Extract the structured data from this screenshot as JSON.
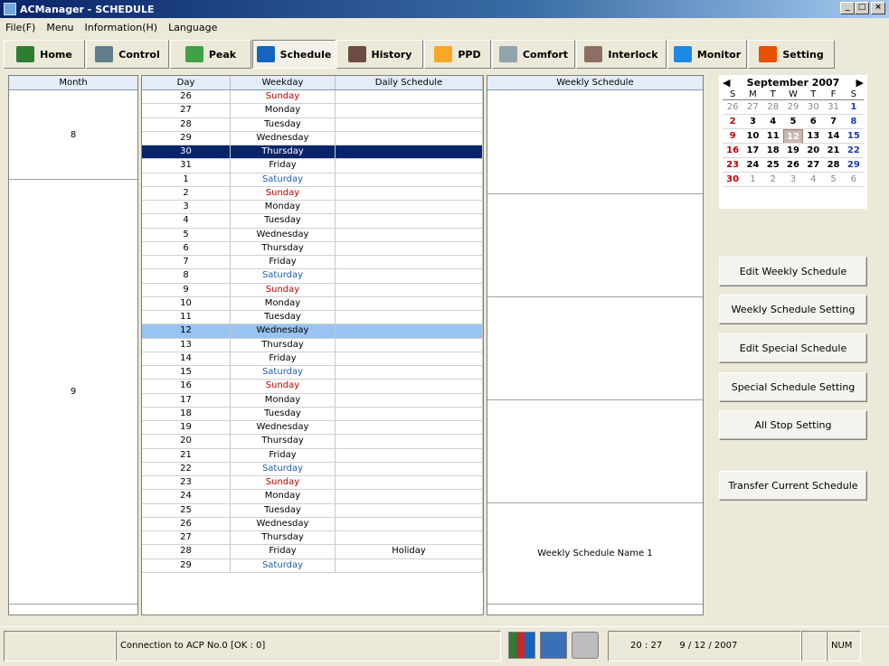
{
  "window": {
    "title": "ACManager - SCHEDULE"
  },
  "menu": [
    "File(F)",
    "Menu",
    "Information(H)",
    "Language"
  ],
  "toolbar": [
    {
      "label": "Home",
      "icon": "home-icon",
      "color": "#2e7d32"
    },
    {
      "label": "Control",
      "icon": "control-icon",
      "color": "#607d8b"
    },
    {
      "label": "Peak",
      "icon": "peak-icon",
      "color": "#43a047"
    },
    {
      "label": "Schedule",
      "icon": "clock-icon",
      "color": "#1565c0",
      "active": true
    },
    {
      "label": "History",
      "icon": "history-icon",
      "color": "#6d4c41"
    },
    {
      "label": "PPD",
      "icon": "ppd-icon",
      "color": "#f9a825"
    },
    {
      "label": "Comfort",
      "icon": "comfort-icon",
      "color": "#90a4ae"
    },
    {
      "label": "Interlock",
      "icon": "interlock-icon",
      "color": "#8d6e63"
    },
    {
      "label": "Monitor",
      "icon": "monitor-icon",
      "color": "#1e88e5"
    },
    {
      "label": "Setting",
      "icon": "setting-icon",
      "color": "#e65100"
    }
  ],
  "month_panel": {
    "header": "Month",
    "months": [
      "8",
      "9"
    ]
  },
  "day_panel": {
    "headers": {
      "day": "Day",
      "weekday": "Weekday",
      "daily": "Daily Schedule"
    },
    "rows": [
      {
        "day": "26",
        "weekday": "Sunday",
        "daily": ""
      },
      {
        "day": "27",
        "weekday": "Monday",
        "daily": ""
      },
      {
        "day": "28",
        "weekday": "Tuesday",
        "daily": ""
      },
      {
        "day": "29",
        "weekday": "Wednesday",
        "daily": ""
      },
      {
        "day": "30",
        "weekday": "Thursday",
        "daily": "",
        "sel": "dark"
      },
      {
        "day": "31",
        "weekday": "Friday",
        "daily": ""
      },
      {
        "day": "1",
        "weekday": "Saturday",
        "daily": ""
      },
      {
        "day": "2",
        "weekday": "Sunday",
        "daily": ""
      },
      {
        "day": "3",
        "weekday": "Monday",
        "daily": ""
      },
      {
        "day": "4",
        "weekday": "Tuesday",
        "daily": ""
      },
      {
        "day": "5",
        "weekday": "Wednesday",
        "daily": ""
      },
      {
        "day": "6",
        "weekday": "Thursday",
        "daily": ""
      },
      {
        "day": "7",
        "weekday": "Friday",
        "daily": ""
      },
      {
        "day": "8",
        "weekday": "Saturday",
        "daily": ""
      },
      {
        "day": "9",
        "weekday": "Sunday",
        "daily": ""
      },
      {
        "day": "10",
        "weekday": "Monday",
        "daily": ""
      },
      {
        "day": "11",
        "weekday": "Tuesday",
        "daily": ""
      },
      {
        "day": "12",
        "weekday": "Wednesday",
        "daily": "",
        "sel": "light"
      },
      {
        "day": "13",
        "weekday": "Thursday",
        "daily": ""
      },
      {
        "day": "14",
        "weekday": "Friday",
        "daily": ""
      },
      {
        "day": "15",
        "weekday": "Saturday",
        "daily": ""
      },
      {
        "day": "16",
        "weekday": "Sunday",
        "daily": ""
      },
      {
        "day": "17",
        "weekday": "Monday",
        "daily": ""
      },
      {
        "day": "18",
        "weekday": "Tuesday",
        "daily": ""
      },
      {
        "day": "19",
        "weekday": "Wednesday",
        "daily": ""
      },
      {
        "day": "20",
        "weekday": "Thursday",
        "daily": ""
      },
      {
        "day": "21",
        "weekday": "Friday",
        "daily": ""
      },
      {
        "day": "22",
        "weekday": "Saturday",
        "daily": ""
      },
      {
        "day": "23",
        "weekday": "Sunday",
        "daily": ""
      },
      {
        "day": "24",
        "weekday": "Monday",
        "daily": ""
      },
      {
        "day": "25",
        "weekday": "Tuesday",
        "daily": ""
      },
      {
        "day": "26",
        "weekday": "Wednesday",
        "daily": ""
      },
      {
        "day": "27",
        "weekday": "Thursday",
        "daily": ""
      },
      {
        "day": "28",
        "weekday": "Friday",
        "daily": "Holiday"
      },
      {
        "day": "29",
        "weekday": "Saturday",
        "daily": ""
      }
    ]
  },
  "weekly_panel": {
    "header": "Weekly Schedule",
    "blocks": [
      "",
      "",
      "",
      "",
      "Weekly Schedule Name 1"
    ]
  },
  "calendar": {
    "title": "September 2007",
    "dow": [
      "S",
      "M",
      "T",
      "W",
      "T",
      "F",
      "S"
    ],
    "weeks": [
      [
        "26",
        "27",
        "28",
        "29",
        "30",
        "31",
        "1"
      ],
      [
        "2",
        "3",
        "4",
        "5",
        "6",
        "7",
        "8"
      ],
      [
        "9",
        "10",
        "11",
        "12",
        "13",
        "14",
        "15"
      ],
      [
        "16",
        "17",
        "18",
        "19",
        "20",
        "21",
        "22"
      ],
      [
        "23",
        "24",
        "25",
        "26",
        "27",
        "28",
        "29"
      ],
      [
        "30",
        "1",
        "2",
        "3",
        "4",
        "5",
        "6"
      ]
    ],
    "today": "12"
  },
  "actions": {
    "edit_weekly": "Edit Weekly Schedule",
    "weekly_setting": "Weekly Schedule Setting",
    "edit_special": "Edit Special Schedule",
    "special_setting": "Special Schedule Setting",
    "all_stop": "All Stop Setting",
    "transfer": "Transfer Current Schedule"
  },
  "status": {
    "connection": "Connection to ACP No.0 [OK : 0]",
    "time": "20 : 27",
    "date": "9 / 12 / 2007",
    "num": "NUM"
  }
}
